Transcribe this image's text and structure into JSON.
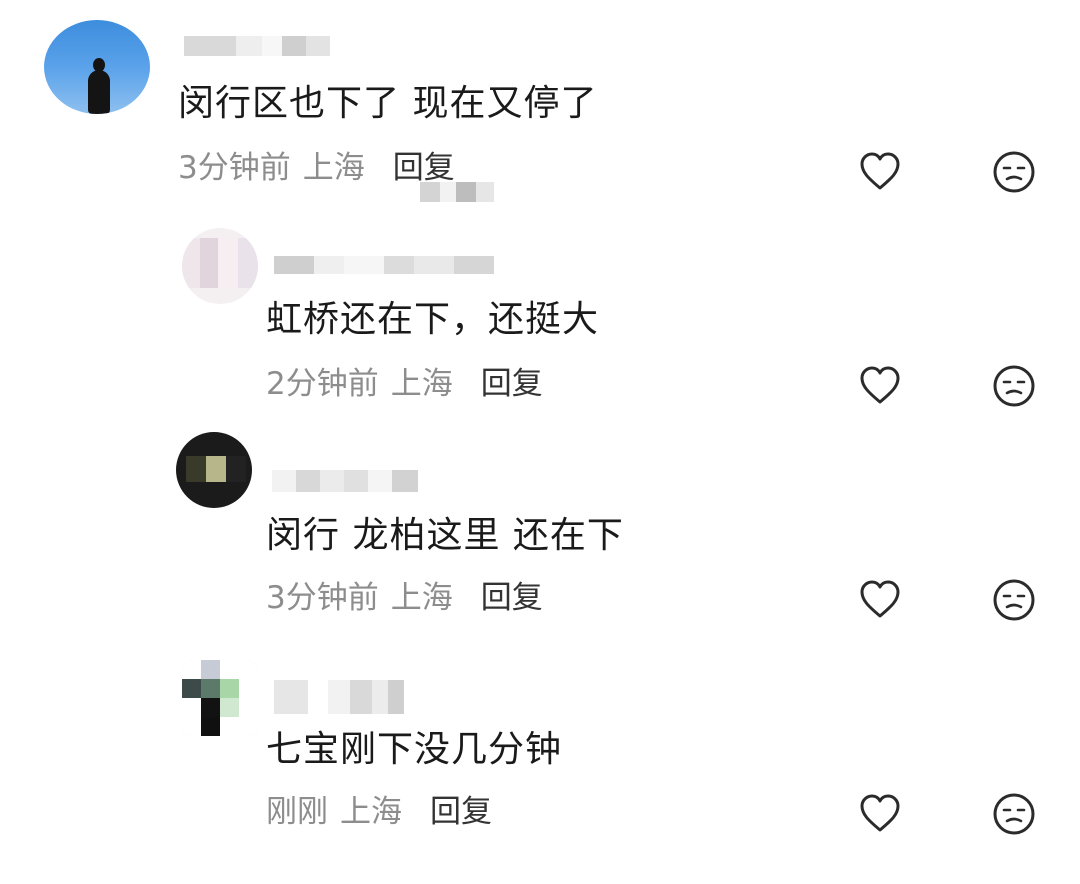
{
  "comments": [
    {
      "level": "top",
      "text": "闵行区也下了  现在又停了",
      "time": "3分钟前",
      "location": "上海",
      "reply_label": "回复",
      "like_icon": "heart-outline-icon",
      "dislike_icon": "neutral-face-icon"
    },
    {
      "level": "reply",
      "text": "虹桥还在下，还挺大",
      "time": "2分钟前",
      "location": "上海",
      "reply_label": "回复",
      "like_icon": "heart-outline-icon",
      "dislike_icon": "neutral-face-icon"
    },
    {
      "level": "reply",
      "text": "闵行 龙柏这里 还在下",
      "time": "3分钟前",
      "location": "上海",
      "reply_label": "回复",
      "like_icon": "heart-outline-icon",
      "dislike_icon": "neutral-face-icon"
    },
    {
      "level": "reply",
      "text": "七宝刚下没几分钟",
      "time": "刚刚",
      "location": "上海",
      "reply_label": "回复",
      "like_icon": "heart-outline-icon",
      "dislike_icon": "neutral-face-icon"
    }
  ],
  "colors": {
    "text": "#1a1a1a",
    "meta": "#8d8d8d",
    "reply": "#333333",
    "icon": "#2b2b2b"
  }
}
